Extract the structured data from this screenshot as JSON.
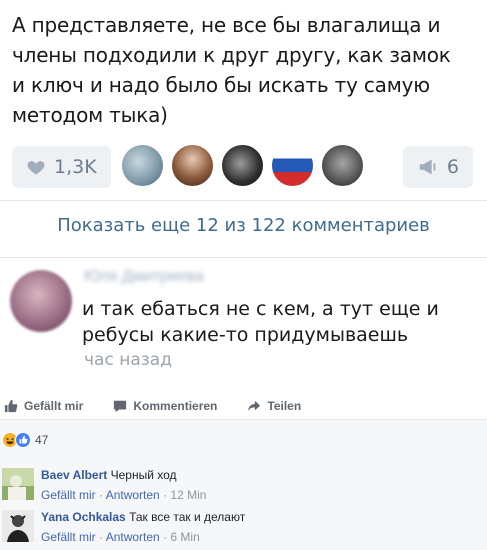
{
  "vk": {
    "post_text_lines": [
      "А представляете, не все бы влагалища и",
      "члены подходили к друг другу, как замок",
      "и ключ и надо было бы искать ту самую",
      "методом тыка)"
    ],
    "likes": "1,3K",
    "shares": "6",
    "show_more": "Показать еще 12 из 122 комментариев",
    "comment": {
      "author": "Юля Дмитриева",
      "text_lines": [
        "и так ебаться не с кем, а тут еще и",
        "ребусы какие-то придумываешь"
      ],
      "time": "час назад"
    }
  },
  "fb": {
    "actions": {
      "like": "Gefällt mir",
      "comment": "Kommentieren",
      "share": "Teilen"
    },
    "reaction_count": "47",
    "comments": [
      {
        "author": "Baev Albert",
        "text": "Черный ход",
        "like": "Gefällt mir",
        "reply": "Antworten",
        "time": "12 Min"
      },
      {
        "author": "Yana Ochkalas",
        "text": "Так все так и делают",
        "like": "Gefällt mir",
        "reply": "Antworten",
        "time": "6 Min"
      }
    ]
  },
  "colors": {
    "vk_link": "#3f6b8e",
    "fb_link": "#365899",
    "fb_panel": "#f6f7f9"
  }
}
